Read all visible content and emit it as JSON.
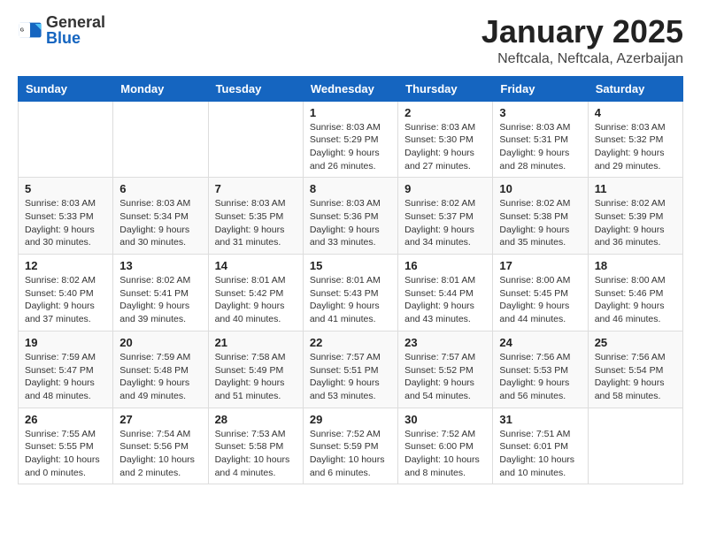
{
  "header": {
    "logo_general": "General",
    "logo_blue": "Blue",
    "month_title": "January 2025",
    "location": "Neftcala, Neftcala, Azerbaijan"
  },
  "weekdays": [
    "Sunday",
    "Monday",
    "Tuesday",
    "Wednesday",
    "Thursday",
    "Friday",
    "Saturday"
  ],
  "weeks": [
    [
      {
        "day": "",
        "info": ""
      },
      {
        "day": "",
        "info": ""
      },
      {
        "day": "",
        "info": ""
      },
      {
        "day": "1",
        "info": "Sunrise: 8:03 AM\nSunset: 5:29 PM\nDaylight: 9 hours\nand 26 minutes."
      },
      {
        "day": "2",
        "info": "Sunrise: 8:03 AM\nSunset: 5:30 PM\nDaylight: 9 hours\nand 27 minutes."
      },
      {
        "day": "3",
        "info": "Sunrise: 8:03 AM\nSunset: 5:31 PM\nDaylight: 9 hours\nand 28 minutes."
      },
      {
        "day": "4",
        "info": "Sunrise: 8:03 AM\nSunset: 5:32 PM\nDaylight: 9 hours\nand 29 minutes."
      }
    ],
    [
      {
        "day": "5",
        "info": "Sunrise: 8:03 AM\nSunset: 5:33 PM\nDaylight: 9 hours\nand 30 minutes."
      },
      {
        "day": "6",
        "info": "Sunrise: 8:03 AM\nSunset: 5:34 PM\nDaylight: 9 hours\nand 30 minutes."
      },
      {
        "day": "7",
        "info": "Sunrise: 8:03 AM\nSunset: 5:35 PM\nDaylight: 9 hours\nand 31 minutes."
      },
      {
        "day": "8",
        "info": "Sunrise: 8:03 AM\nSunset: 5:36 PM\nDaylight: 9 hours\nand 33 minutes."
      },
      {
        "day": "9",
        "info": "Sunrise: 8:02 AM\nSunset: 5:37 PM\nDaylight: 9 hours\nand 34 minutes."
      },
      {
        "day": "10",
        "info": "Sunrise: 8:02 AM\nSunset: 5:38 PM\nDaylight: 9 hours\nand 35 minutes."
      },
      {
        "day": "11",
        "info": "Sunrise: 8:02 AM\nSunset: 5:39 PM\nDaylight: 9 hours\nand 36 minutes."
      }
    ],
    [
      {
        "day": "12",
        "info": "Sunrise: 8:02 AM\nSunset: 5:40 PM\nDaylight: 9 hours\nand 37 minutes."
      },
      {
        "day": "13",
        "info": "Sunrise: 8:02 AM\nSunset: 5:41 PM\nDaylight: 9 hours\nand 39 minutes."
      },
      {
        "day": "14",
        "info": "Sunrise: 8:01 AM\nSunset: 5:42 PM\nDaylight: 9 hours\nand 40 minutes."
      },
      {
        "day": "15",
        "info": "Sunrise: 8:01 AM\nSunset: 5:43 PM\nDaylight: 9 hours\nand 41 minutes."
      },
      {
        "day": "16",
        "info": "Sunrise: 8:01 AM\nSunset: 5:44 PM\nDaylight: 9 hours\nand 43 minutes."
      },
      {
        "day": "17",
        "info": "Sunrise: 8:00 AM\nSunset: 5:45 PM\nDaylight: 9 hours\nand 44 minutes."
      },
      {
        "day": "18",
        "info": "Sunrise: 8:00 AM\nSunset: 5:46 PM\nDaylight: 9 hours\nand 46 minutes."
      }
    ],
    [
      {
        "day": "19",
        "info": "Sunrise: 7:59 AM\nSunset: 5:47 PM\nDaylight: 9 hours\nand 48 minutes."
      },
      {
        "day": "20",
        "info": "Sunrise: 7:59 AM\nSunset: 5:48 PM\nDaylight: 9 hours\nand 49 minutes."
      },
      {
        "day": "21",
        "info": "Sunrise: 7:58 AM\nSunset: 5:49 PM\nDaylight: 9 hours\nand 51 minutes."
      },
      {
        "day": "22",
        "info": "Sunrise: 7:57 AM\nSunset: 5:51 PM\nDaylight: 9 hours\nand 53 minutes."
      },
      {
        "day": "23",
        "info": "Sunrise: 7:57 AM\nSunset: 5:52 PM\nDaylight: 9 hours\nand 54 minutes."
      },
      {
        "day": "24",
        "info": "Sunrise: 7:56 AM\nSunset: 5:53 PM\nDaylight: 9 hours\nand 56 minutes."
      },
      {
        "day": "25",
        "info": "Sunrise: 7:56 AM\nSunset: 5:54 PM\nDaylight: 9 hours\nand 58 minutes."
      }
    ],
    [
      {
        "day": "26",
        "info": "Sunrise: 7:55 AM\nSunset: 5:55 PM\nDaylight: 10 hours\nand 0 minutes."
      },
      {
        "day": "27",
        "info": "Sunrise: 7:54 AM\nSunset: 5:56 PM\nDaylight: 10 hours\nand 2 minutes."
      },
      {
        "day": "28",
        "info": "Sunrise: 7:53 AM\nSunset: 5:58 PM\nDaylight: 10 hours\nand 4 minutes."
      },
      {
        "day": "29",
        "info": "Sunrise: 7:52 AM\nSunset: 5:59 PM\nDaylight: 10 hours\nand 6 minutes."
      },
      {
        "day": "30",
        "info": "Sunrise: 7:52 AM\nSunset: 6:00 PM\nDaylight: 10 hours\nand 8 minutes."
      },
      {
        "day": "31",
        "info": "Sunrise: 7:51 AM\nSunset: 6:01 PM\nDaylight: 10 hours\nand 10 minutes."
      },
      {
        "day": "",
        "info": ""
      }
    ]
  ]
}
